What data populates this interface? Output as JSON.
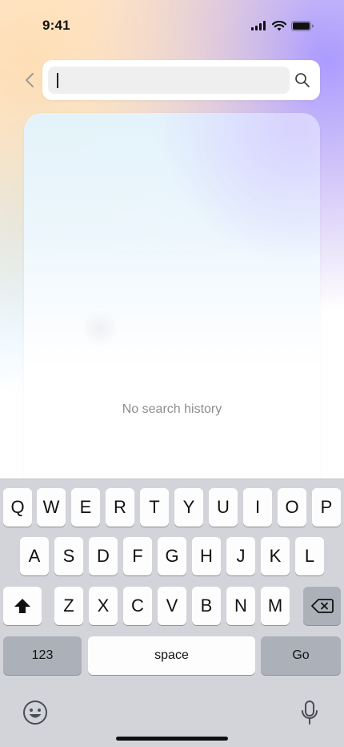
{
  "status_bar": {
    "time": "9:41"
  },
  "icons": {
    "back": "chevron-left-icon",
    "search": "search-icon",
    "shift": "shift-icon",
    "delete": "backspace-icon",
    "emoji": "emoji-icon",
    "mic": "microphone-icon",
    "signal": "cellular-signal-icon",
    "wifi": "wifi-icon",
    "battery": "battery-icon"
  },
  "search": {
    "value": "",
    "placeholder": ""
  },
  "history": {
    "empty_message": "No search history"
  },
  "keyboard": {
    "row1": [
      "Q",
      "W",
      "E",
      "R",
      "T",
      "Y",
      "U",
      "I",
      "O",
      "P"
    ],
    "row2": [
      "A",
      "S",
      "D",
      "F",
      "G",
      "H",
      "J",
      "K",
      "L"
    ],
    "row3": [
      "Z",
      "X",
      "C",
      "V",
      "B",
      "N",
      "M"
    ],
    "numbers_label": "123",
    "space_label": "space",
    "go_label": "Go"
  },
  "colors": {
    "keyboard_bg": "#d2d4da",
    "key_bg": "#fdfdfe",
    "dark_key_bg": "#acb1b9",
    "empty_text": "#8d8d8d"
  }
}
